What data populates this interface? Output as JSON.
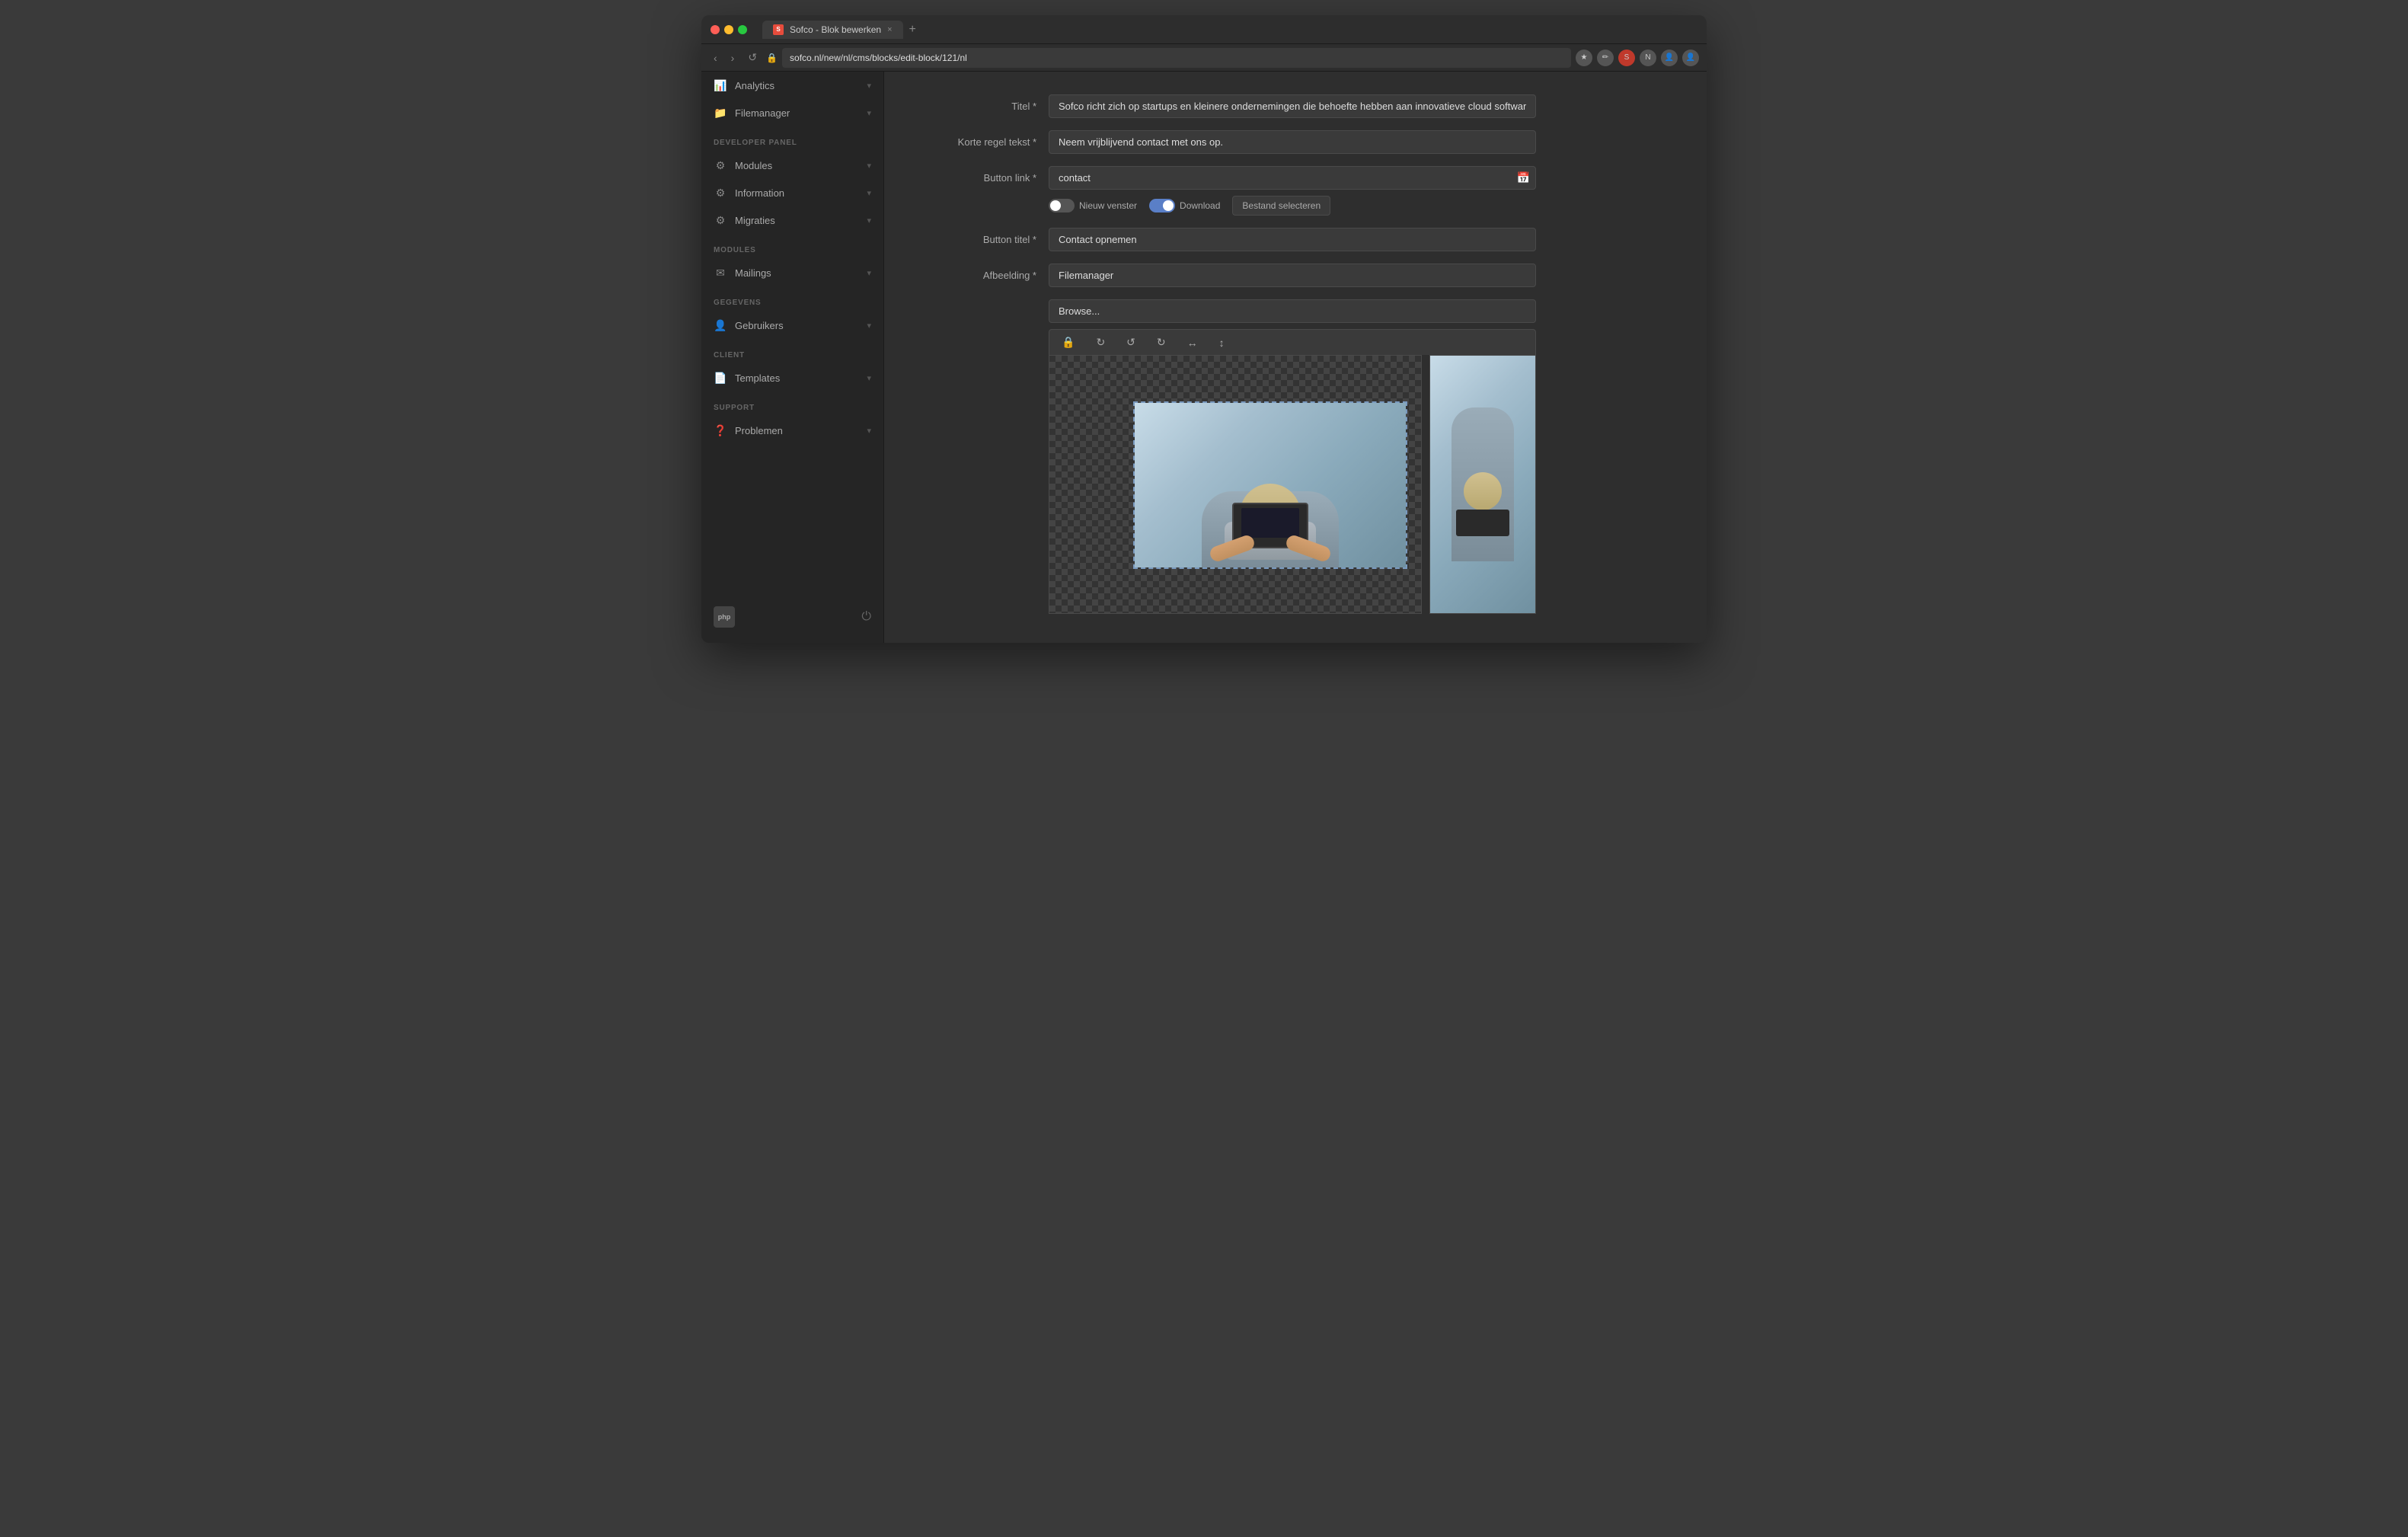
{
  "browser": {
    "traffic_lights": [
      "close",
      "minimize",
      "maximize"
    ],
    "tab": {
      "favicon_text": "S",
      "title": "Sofco - Blok bewerken",
      "close_icon": "×"
    },
    "new_tab_icon": "+",
    "nav": {
      "back": "‹",
      "forward": "›",
      "reload": "↺",
      "url": "sofco.nl/new/nl/cms/blocks/edit-block/121/nl",
      "lock_icon": "🔒"
    },
    "toolbar_icons": [
      "★",
      "✏",
      "🌐",
      "N",
      "👤",
      "👤"
    ]
  },
  "sidebar": {
    "sections": [
      {
        "items": [
          {
            "id": "analytics",
            "icon": "📊",
            "label": "Analytics",
            "has_chevron": true
          },
          {
            "id": "filemanager",
            "icon": "📁",
            "label": "Filemanager",
            "has_chevron": true
          }
        ]
      },
      {
        "label": "DEVELOPER PANEL",
        "items": [
          {
            "id": "modules",
            "icon": "🔧",
            "label": "Modules",
            "has_chevron": true
          },
          {
            "id": "information",
            "icon": "🔧",
            "label": "Information",
            "has_chevron": true
          },
          {
            "id": "migraties",
            "icon": "🔧",
            "label": "Migraties",
            "has_chevron": true
          }
        ]
      },
      {
        "label": "MODULES",
        "items": [
          {
            "id": "mailings",
            "icon": "✉",
            "label": "Mailings",
            "has_chevron": true
          }
        ]
      },
      {
        "label": "GEGEVENS",
        "items": [
          {
            "id": "gebruikers",
            "icon": "👤",
            "label": "Gebruikers",
            "has_chevron": true
          }
        ]
      },
      {
        "label": "CLIENT",
        "items": [
          {
            "id": "templates",
            "icon": "📄",
            "label": "Templates",
            "has_chevron": true
          }
        ]
      },
      {
        "label": "SUPPORT",
        "items": [
          {
            "id": "problemen",
            "icon": "❓",
            "label": "Problemen",
            "has_chevron": true
          }
        ]
      }
    ],
    "footer": {
      "php_label": "php",
      "power_icon": "⏻"
    }
  },
  "form": {
    "fields": {
      "titel_label": "Titel *",
      "titel_value": "Sofco richt zich op startups en kleinere ondernemingen die behoefte hebben aan innovatieve cloud software oploss",
      "korte_regel_label": "Korte regel tekst *",
      "korte_regel_value": "Neem vrijblijvend contact met ons op.",
      "button_link_label": "Button link *",
      "button_link_value": "contact",
      "nieuw_venster_label": "Nieuw venster",
      "download_label": "Download",
      "bestand_selecteren_label": "Bestand selecteren",
      "button_titel_label": "Button titel *",
      "button_titel_value": "Contact opnemen",
      "afbeelding_label": "Afbeelding *",
      "afbeelding_value": "Filemanager",
      "browse_label": "Browse..."
    },
    "image_toolbar": {
      "lock_icon": "🔒",
      "refresh_icon": "↻",
      "undo_icon": "↺",
      "redo_icon": "↻",
      "flip_icon": "↔",
      "arrows_icon": "↕"
    }
  }
}
